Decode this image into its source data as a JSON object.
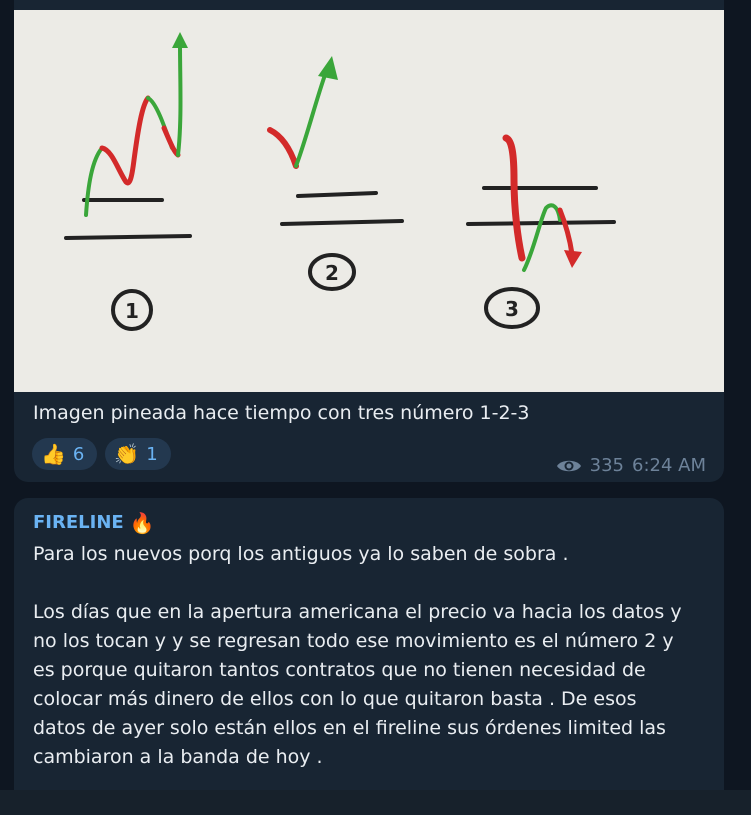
{
  "message1": {
    "photo_labels": [
      "1",
      "2",
      "3"
    ],
    "caption": "Imagen pineada hace tiempo con tres número 1-2-3",
    "reactions": [
      {
        "emoji": "👍",
        "count": "6"
      },
      {
        "emoji": "👏",
        "count": "1"
      }
    ],
    "views": "335",
    "time": "6:24 AM"
  },
  "message2": {
    "sender": "FIRELINE",
    "sender_emoji": "🔥",
    "line1": "Para los nuevos porq los antiguos ya lo saben de sobra .",
    "paragraph": [
      "Los días que en la apertura americana el precio va hacia los datos y",
      "no los tocan y y se regresan todo ese movimiento es el número 2 y",
      "es porque quitaron tantos contratos que no tienen necesidad de",
      "colocar más dinero de ellos con lo que quitaron basta . De esos",
      "datos de ayer solo están ellos en el fireline sus órdenes limited las",
      "cambiaron a la banda de hoy ."
    ]
  },
  "colors": {
    "background": "#0e1621",
    "bubble": "#182533",
    "accent": "#6ab3f3",
    "meta": "#6d8299",
    "reaction_bg": "#23384f"
  },
  "icons": {
    "views": "eye-icon"
  }
}
